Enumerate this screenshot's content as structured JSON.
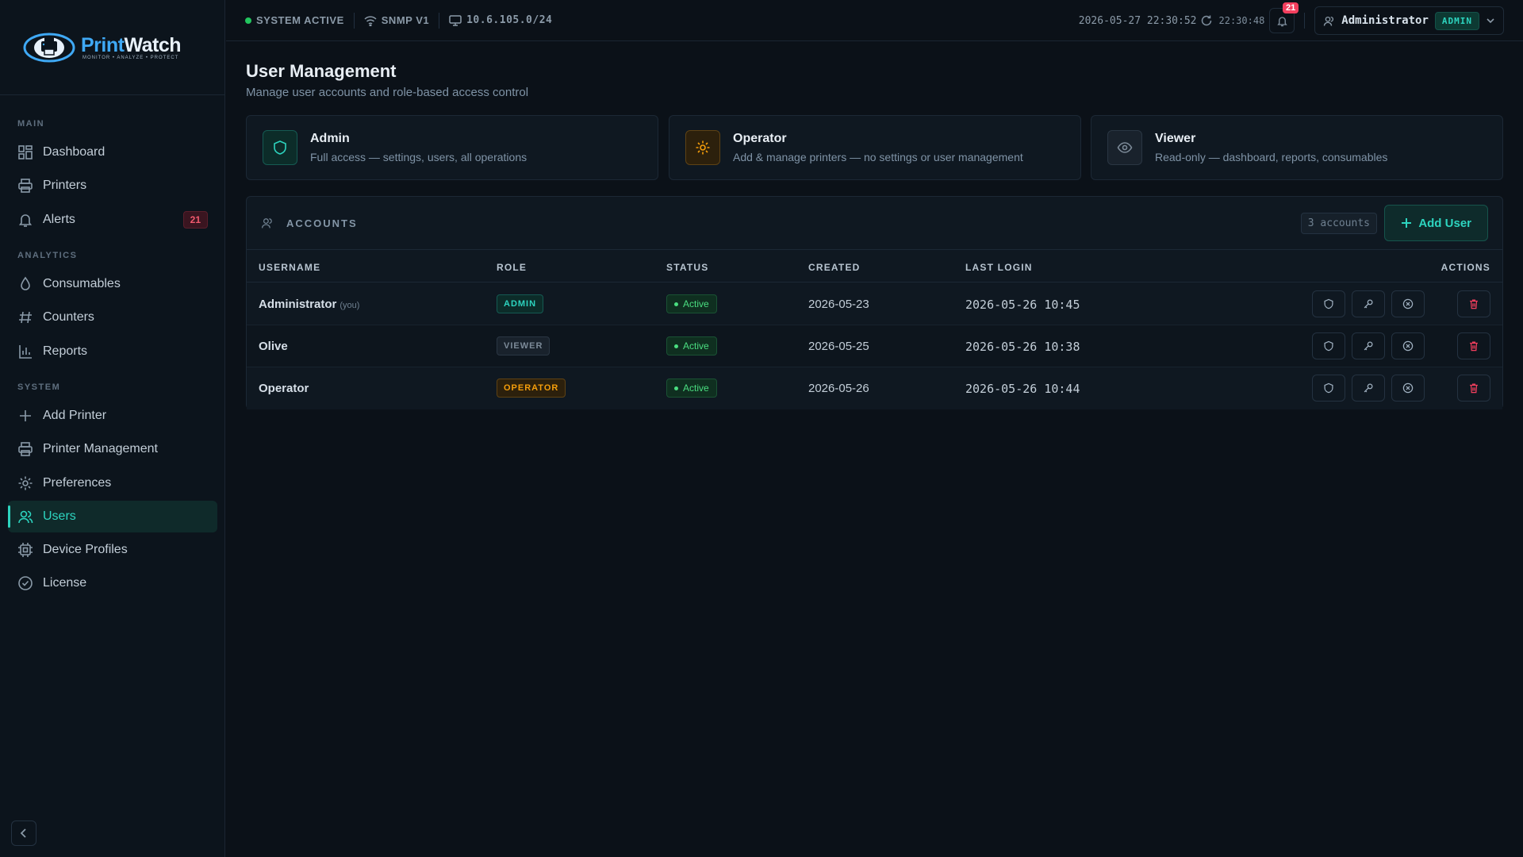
{
  "brand": {
    "name_a": "Print",
    "name_b": "Watch",
    "tagline": "MONITOR • ANALYZE • PROTECT"
  },
  "sidebar": {
    "sections": {
      "main": "MAIN",
      "analytics": "ANALYTICS",
      "system": "SYSTEM"
    },
    "items": [
      {
        "label": "Dashboard",
        "icon": "dashboard-icon"
      },
      {
        "label": "Printers",
        "icon": "printer-icon"
      },
      {
        "label": "Alerts",
        "icon": "bell-icon",
        "badge": "21"
      },
      {
        "label": "Consumables",
        "icon": "drop-icon"
      },
      {
        "label": "Counters",
        "icon": "hash-icon"
      },
      {
        "label": "Reports",
        "icon": "bar-chart-icon"
      },
      {
        "label": "Add Printer",
        "icon": "plus-icon"
      },
      {
        "label": "Printer Management",
        "icon": "printer-icon"
      },
      {
        "label": "Preferences",
        "icon": "gear-icon"
      },
      {
        "label": "Users",
        "icon": "users-icon",
        "active": true
      },
      {
        "label": "Device Profiles",
        "icon": "chip-icon"
      },
      {
        "label": "License",
        "icon": "check-circle-icon"
      }
    ]
  },
  "topbar": {
    "status": "SYSTEM ACTIVE",
    "snmp": "SNMP V1",
    "subnet": "10.6.105.0/24",
    "datetime": "2026-05-27 22:30:52",
    "refresh_time": "22:30:48",
    "notif_count": "21",
    "user": "Administrator",
    "user_role": "ADMIN"
  },
  "page": {
    "title": "User Management",
    "subtitle": "Manage user accounts and role-based access control"
  },
  "roles": [
    {
      "title": "Admin",
      "desc": "Full access — settings, users, all operations",
      "color": "#2dd4bf"
    },
    {
      "title": "Operator",
      "desc": "Add & manage printers — no settings or user management",
      "color": "#f59e0b"
    },
    {
      "title": "Viewer",
      "desc": "Read-only — dashboard, reports, consumables",
      "color": "#7c8a98"
    }
  ],
  "accounts": {
    "title": "ACCOUNTS",
    "count": "3 accounts",
    "add_label": "Add User",
    "columns": [
      "USERNAME",
      "ROLE",
      "STATUS",
      "CREATED",
      "LAST LOGIN",
      "ACTIONS"
    ],
    "rows": [
      {
        "username": "Administrator",
        "you": "(you)",
        "role": "ADMIN",
        "status": "Active",
        "created": "2026-05-23",
        "last_login": "2026-05-26 10:45"
      },
      {
        "username": "Olive",
        "you": "",
        "role": "VIEWER",
        "status": "Active",
        "created": "2026-05-25",
        "last_login": "2026-05-26 10:38"
      },
      {
        "username": "Operator",
        "you": "",
        "role": "OPERATOR",
        "status": "Active",
        "created": "2026-05-26",
        "last_login": "2026-05-26 10:44"
      }
    ]
  }
}
